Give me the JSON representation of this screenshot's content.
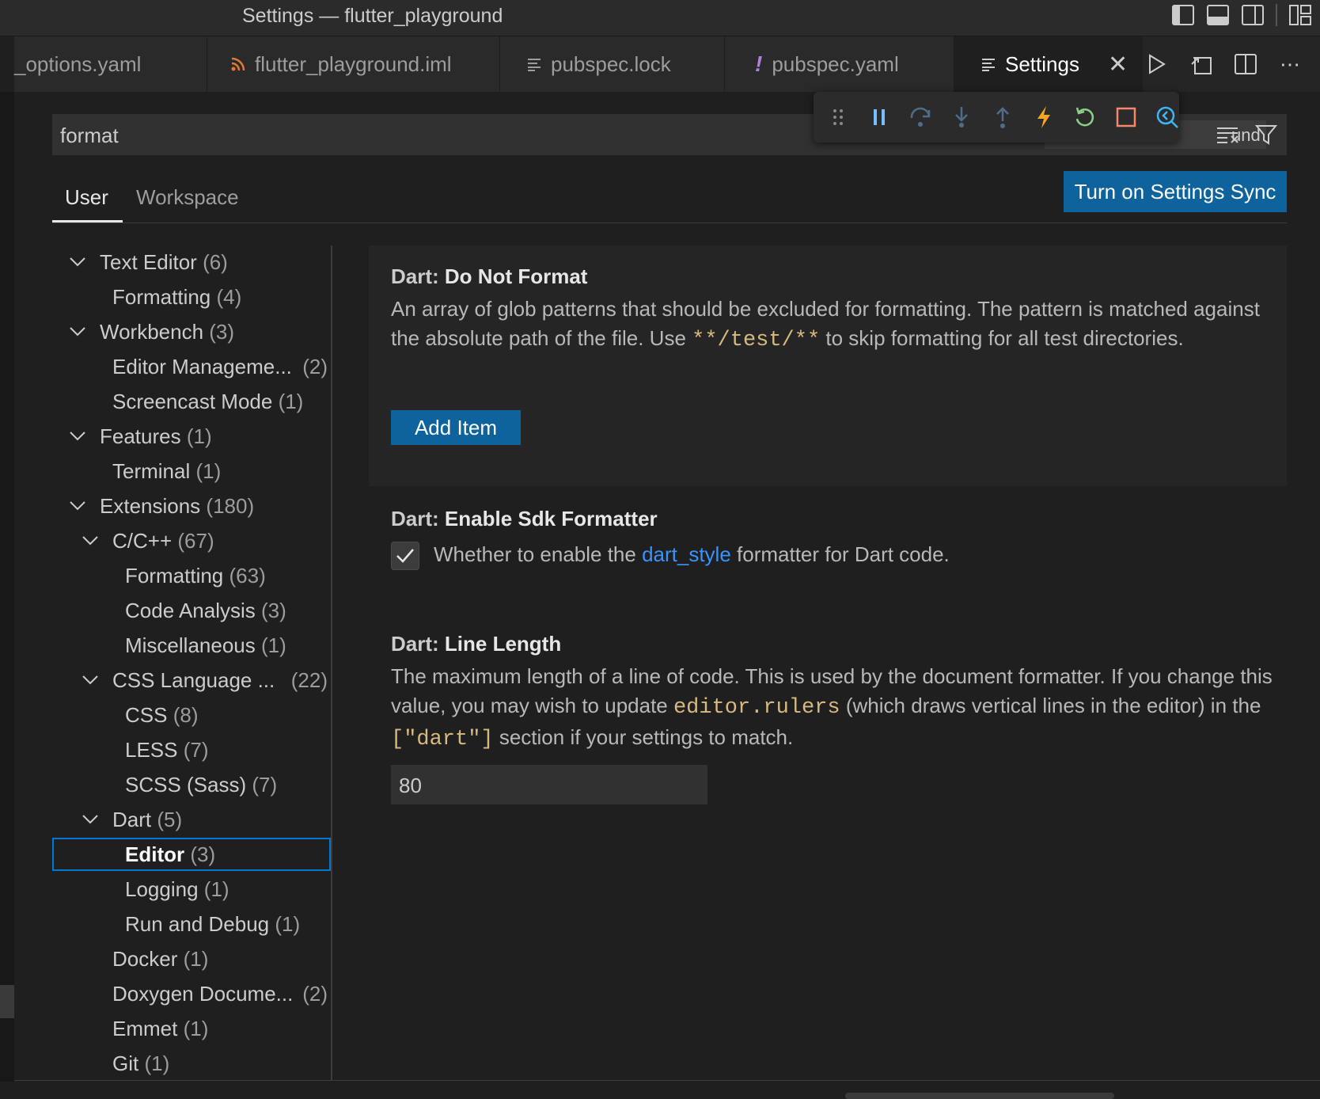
{
  "window": {
    "title": "Settings — flutter_playground"
  },
  "tabs": [
    {
      "label": "_options.yaml",
      "icon": "none"
    },
    {
      "label": "flutter_playground.iml",
      "icon": "rss-icon"
    },
    {
      "label": "pubspec.lock",
      "icon": "lines-icon"
    },
    {
      "label": "pubspec.yaml",
      "icon": "exclamation-icon"
    },
    {
      "label": "Settings",
      "icon": "lines-icon",
      "active": true
    }
  ],
  "search": {
    "value": "format",
    "badge": "und"
  },
  "scope": {
    "user": "User",
    "workspace": "Workspace",
    "active": "User"
  },
  "sync_button": "Turn on Settings Sync",
  "toc": [
    {
      "label": "Text Editor",
      "count": "(6)",
      "level": 0,
      "expanded": true
    },
    {
      "label": "Formatting",
      "count": "(4)",
      "level": 1
    },
    {
      "label": "Workbench",
      "count": "(3)",
      "level": 0,
      "expanded": true
    },
    {
      "label": "Editor Manageme...",
      "count": "(2)",
      "level": 1
    },
    {
      "label": "Screencast Mode",
      "count": "(1)",
      "level": 1
    },
    {
      "label": "Features",
      "count": "(1)",
      "level": 0,
      "expanded": true
    },
    {
      "label": "Terminal",
      "count": "(1)",
      "level": 1
    },
    {
      "label": "Extensions",
      "count": "(180)",
      "level": 0,
      "expanded": true
    },
    {
      "label": "C/C++",
      "count": "(67)",
      "level": 1,
      "expanded": true
    },
    {
      "label": "Formatting",
      "count": "(63)",
      "level": 2
    },
    {
      "label": "Code Analysis",
      "count": "(3)",
      "level": 2
    },
    {
      "label": "Miscellaneous",
      "count": "(1)",
      "level": 2
    },
    {
      "label": "CSS Language ...",
      "count": "(22)",
      "level": 1,
      "expanded": true
    },
    {
      "label": "CSS",
      "count": "(8)",
      "level": 2
    },
    {
      "label": "LESS",
      "count": "(7)",
      "level": 2
    },
    {
      "label": "SCSS (Sass)",
      "count": "(7)",
      "level": 2
    },
    {
      "label": "Dart",
      "count": "(5)",
      "level": 1,
      "expanded": true
    },
    {
      "label": "Editor",
      "count": "(3)",
      "level": 2,
      "selected": true
    },
    {
      "label": "Logging",
      "count": "(1)",
      "level": 2
    },
    {
      "label": "Run and Debug",
      "count": "(1)",
      "level": 2
    },
    {
      "label": "Docker",
      "count": "(1)",
      "level": 1
    },
    {
      "label": "Doxygen Docume...",
      "count": "(2)",
      "level": 1
    },
    {
      "label": "Emmet",
      "count": "(1)",
      "level": 1
    },
    {
      "label": "Git",
      "count": "(1)",
      "level": 1
    }
  ],
  "settings": {
    "do_not_format": {
      "category": "Dart:",
      "name": "Do Not Format",
      "desc_1": "An array of glob patterns that should be excluded for formatting. The pattern is matched against the absolute path of the file. Use ",
      "desc_code": "**/test/**",
      "desc_2": " to skip formatting for all test directories.",
      "button": "Add Item"
    },
    "enable_sdk_formatter": {
      "category": "Dart:",
      "name": "Enable Sdk Formatter",
      "desc_1": "Whether to enable the ",
      "desc_link": "dart_style",
      "desc_2": " formatter for Dart code.",
      "checked": true
    },
    "line_length": {
      "category": "Dart:",
      "name": "Line Length",
      "desc_1": "The maximum length of a line of code. This is used by the document formatter. If you change this value, you may wish to update ",
      "desc_code_1": "editor.rulers",
      "desc_2": " (which draws vertical lines in the editor) in the ",
      "desc_code_2": "[\"dart\"]",
      "desc_3": " section if your settings to match.",
      "value": "80"
    }
  },
  "colors": {
    "accent": "#0e639c",
    "focus": "#0078d4",
    "link": "#3794ff",
    "code": "#d7ba7d"
  }
}
